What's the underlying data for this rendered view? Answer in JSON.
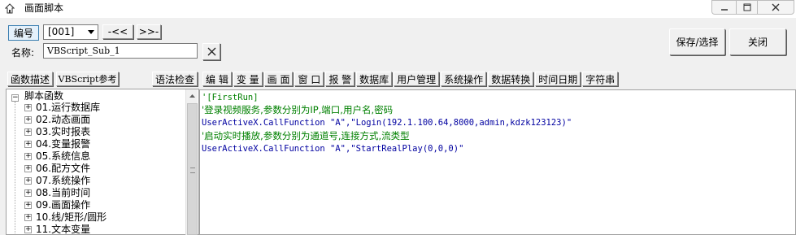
{
  "window": {
    "title": "画面脚本"
  },
  "header": {
    "code_label": "编号",
    "code_value": "[001]",
    "prev_label": "-<<",
    "next_label": ">>-",
    "name_label": "名称:",
    "name_value": "VBScript_Sub_1",
    "save_label": "保存/选择",
    "close_label": "关闭"
  },
  "buttons": {
    "func_desc": "函数描述",
    "vbs_ref": "VBScript参考",
    "syntax_check": "语法检查"
  },
  "toolbar": [
    "编 辑",
    "变 量",
    "画 面",
    "窗 口",
    "报 警",
    "数据库",
    "用户管理",
    "系统操作",
    "数据转换",
    "时间日期",
    "字符串"
  ],
  "tree": {
    "root": "脚本函数",
    "items": [
      "01.运行数据库",
      "02.动态画面",
      "03.实时报表",
      "04.变量报警",
      "05.系统信息",
      "06.配方文件",
      "07.系统操作",
      "08.当前时间",
      "09.画面操作",
      "10.线/矩形/圆形",
      "11.文本变量"
    ]
  },
  "editor": {
    "lines": [
      {
        "type": "comment",
        "text": "'[FirstRun]"
      },
      {
        "type": "comment",
        "text": "'登录视频服务,参数分别为IP,端口,用户名,密码"
      },
      {
        "type": "code",
        "text": "UserActiveX.CallFunction \"A\",\"Login(192.1.100.64,8000,admin,kdzk123123)\""
      },
      {
        "type": "comment",
        "text": "'启动实时播放,参数分别为通道号,连接方式,流类型"
      },
      {
        "type": "code",
        "text": "UserActiveX.CallFunction \"A\",\"StartRealPlay(0,0,0)\""
      }
    ]
  },
  "colors": {
    "comment": "#008000",
    "code": "#0000a0"
  }
}
